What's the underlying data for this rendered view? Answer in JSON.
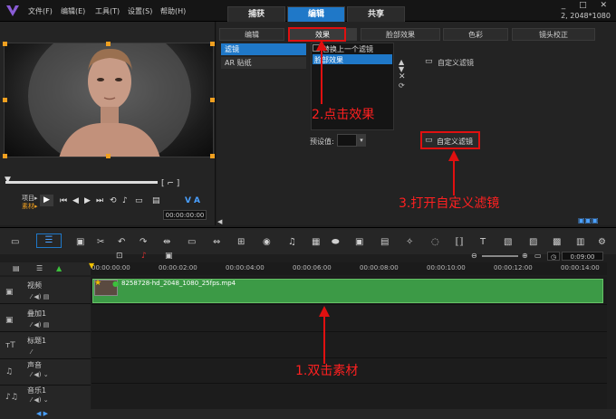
{
  "menu": [
    "文件(F)",
    "编辑(E)",
    "工具(T)",
    "设置(S)",
    "帮助(H)"
  ],
  "tabs": [
    "捕获",
    "编辑",
    "共享"
  ],
  "window": {
    "controls": "_ □ ✕",
    "resolution": "2, 2048*1080"
  },
  "preview": {
    "project_label": "项目▸",
    "clip_label": "素材▸",
    "timecode": "00:00:00:00",
    "vol_label": "V",
    "anti_label": "A"
  },
  "options": {
    "tabs": [
      "编辑",
      "效果",
      "脸部效果",
      "色彩",
      "镜头校正"
    ],
    "left_list": [
      "滤镜",
      "AR 贴纸"
    ],
    "replace_label": "替换上一个滤镜",
    "filter_item": "脸部效果",
    "custom_filter_label": "自定义滤镜",
    "preset_label": "预设值:",
    "open_custom_filter": "自定义滤镜"
  },
  "annotations": [
    "2.点击效果",
    "3.打开自定义滤镜",
    "1.双击素材"
  ],
  "timeline": {
    "ticks": [
      "00:00:00:00",
      "00:00:02:00",
      "00:00:04:00",
      "00:00:06:00",
      "00:00:08:00",
      "00:00:10:00",
      "00:00:12:00",
      "00:00:14:00"
    ],
    "zoom_time": "0:09:00",
    "tracks": [
      "视频",
      "叠加1",
      "标题1",
      "声音",
      "音乐1"
    ],
    "clip_name": "8258728-hd_2048_1080_25fps.mp4"
  }
}
